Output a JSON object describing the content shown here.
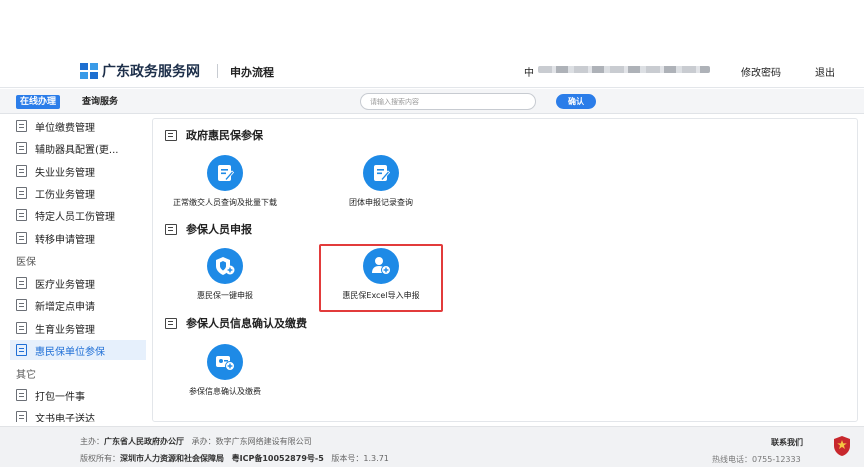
{
  "header": {
    "site_name": "广东政务服务网",
    "page_name": "申办流程",
    "user_prefix": "中",
    "change_password": "修改密码",
    "logout": "退出"
  },
  "nav": {
    "tabs": [
      {
        "label": "在线办理",
        "active": true
      },
      {
        "label": "查询服务",
        "active": false
      }
    ],
    "search_placeholder": "请输入搜索内容",
    "confirm_label": "确认"
  },
  "sidebar": {
    "items": [
      {
        "label": "单位缴费管理"
      },
      {
        "label": "辅助器具配置(更..."
      },
      {
        "label": "失业业务管理"
      },
      {
        "label": "工伤业务管理"
      },
      {
        "label": "特定人员工伤管理"
      },
      {
        "label": "转移申请管理"
      },
      {
        "label": "医疗业务管理"
      },
      {
        "label": "新增定点申请"
      },
      {
        "label": "生育业务管理"
      },
      {
        "label": "惠民保单位参保",
        "active": true
      },
      {
        "label": "打包一件事"
      },
      {
        "label": "文书电子送达"
      }
    ],
    "groups": [
      "医保",
      "其它"
    ]
  },
  "content": {
    "sections": [
      {
        "title": "政府惠民保参保",
        "tiles": [
          {
            "label": "正常缴交人员查询及批量下载",
            "icon": "edit-doc-icon"
          },
          {
            "label": "团体申报记录查询",
            "icon": "edit-doc-icon"
          }
        ]
      },
      {
        "title": "参保人员申报",
        "tiles": [
          {
            "label": "惠民保一键申报",
            "icon": "shield-plus-icon"
          },
          {
            "label": "惠民保Excel导入申报",
            "icon": "person-plus-icon",
            "highlighted": true
          }
        ]
      },
      {
        "title": "参保人员信息确认及缴费",
        "tiles": [
          {
            "label": "参保信息确认及缴费",
            "icon": "card-plus-icon"
          }
        ]
      }
    ]
  },
  "footer": {
    "host_label": "主办：",
    "host": "广东省人民政府办公厅",
    "undertaker_label": "承办：",
    "undertaker": "数字广东网络建设有限公司",
    "copyright_label": "版权所有：",
    "copyright": "深圳市人力资源和社会保障局",
    "icp": "粤ICP备10052879号-5",
    "version_label": "版本号：",
    "version": "1.3.71",
    "contact_title": "联系我们",
    "hotline_label": "热线电话：",
    "hotline": "0755-12333"
  },
  "colors": {
    "accent": "#2b7de9",
    "icon_blue": "#1e8ae6",
    "highlight": "#e23b3b",
    "footer_bg": "#f1f2f4"
  }
}
